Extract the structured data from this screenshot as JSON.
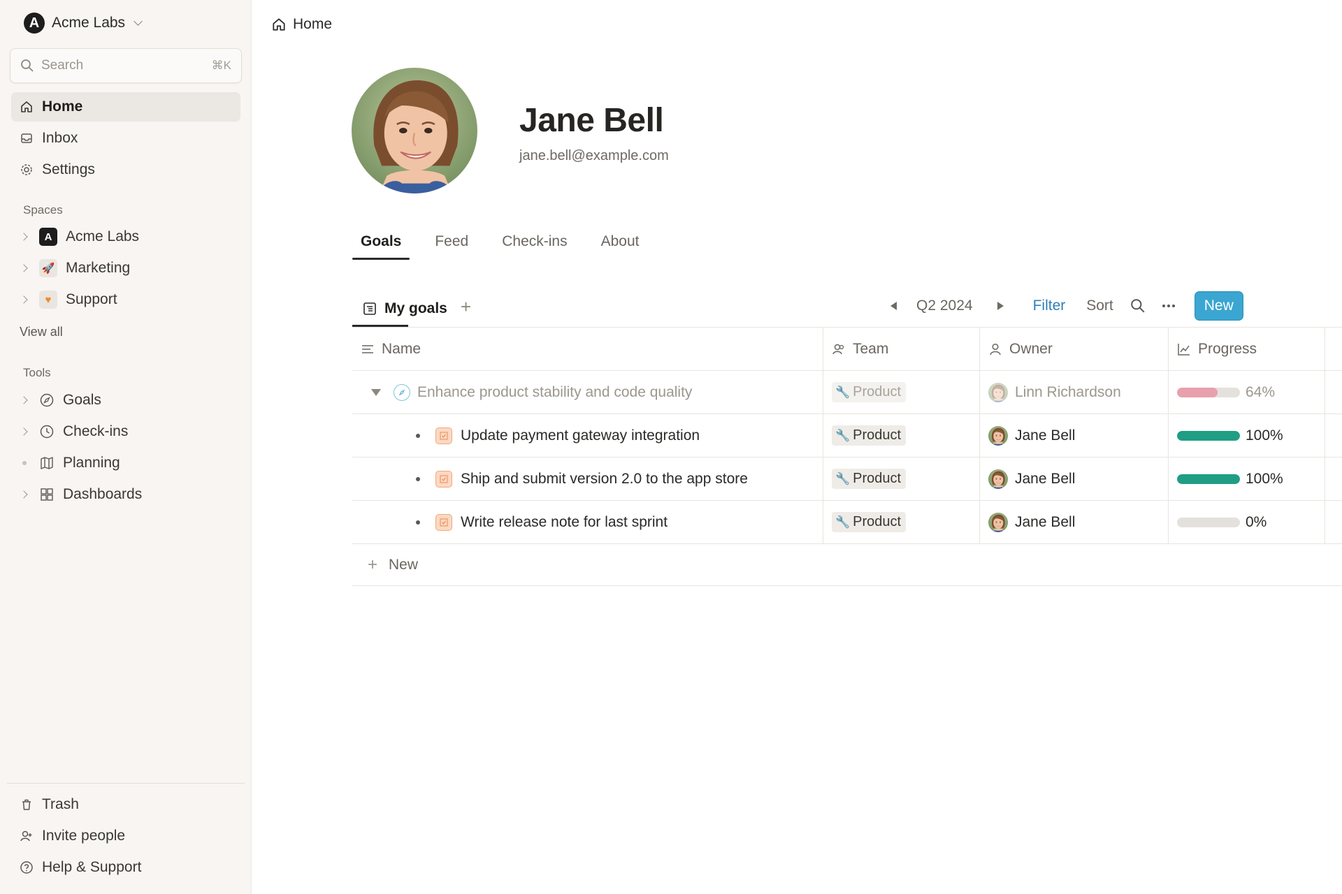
{
  "workspace": {
    "name": "Acme Labs"
  },
  "search": {
    "placeholder": "Search",
    "shortcut": "⌘K"
  },
  "nav": [
    {
      "label": "Home",
      "icon": "home-icon",
      "active": true
    },
    {
      "label": "Inbox",
      "icon": "inbox-icon"
    },
    {
      "label": "Settings",
      "icon": "gear-icon"
    }
  ],
  "spaces": {
    "label": "Spaces",
    "items": [
      {
        "label": "Acme Labs",
        "icon": "acme-logo-icon"
      },
      {
        "label": "Marketing",
        "icon": "rocket-icon"
      },
      {
        "label": "Support",
        "icon": "heart-icon"
      }
    ],
    "view_all": "View all"
  },
  "tools": {
    "label": "Tools",
    "items": [
      {
        "label": "Goals",
        "icon": "compass-icon"
      },
      {
        "label": "Check-ins",
        "icon": "clock-icon"
      },
      {
        "label": "Planning",
        "icon": "map-icon"
      },
      {
        "label": "Dashboards",
        "icon": "grid-icon"
      }
    ]
  },
  "footer": [
    {
      "label": "Trash",
      "icon": "trash-icon"
    },
    {
      "label": "Invite people",
      "icon": "invite-icon"
    },
    {
      "label": "Help & Support",
      "icon": "help-icon"
    }
  ],
  "breadcrumb": {
    "label": "Home"
  },
  "profile": {
    "name": "Jane Bell",
    "email": "jane.bell@example.com"
  },
  "tabs": [
    {
      "label": "Goals",
      "active": true
    },
    {
      "label": "Feed"
    },
    {
      "label": "Check-ins"
    },
    {
      "label": "About"
    }
  ],
  "view": {
    "name": "My goals",
    "period": "Q2 2024",
    "filter": "Filter",
    "sort": "Sort",
    "new": "New"
  },
  "columns": {
    "name": "Name",
    "team": "Team",
    "owner": "Owner",
    "progress": "Progress"
  },
  "rows": [
    {
      "name": "Enhance product stability and code quality",
      "team": "Product",
      "owner": "Linn Richardson",
      "progress": 64,
      "progress_label": "64%",
      "kind": "goal",
      "color": "#e8a0ac"
    },
    {
      "name": "Update payment gateway integration",
      "team": "Product",
      "owner": "Jane Bell",
      "progress": 100,
      "progress_label": "100%",
      "kind": "task",
      "color": "#1f9e84"
    },
    {
      "name": "Ship and submit version 2.0 to the app store",
      "team": "Product",
      "owner": "Jane Bell",
      "progress": 100,
      "progress_label": "100%",
      "kind": "task",
      "color": "#1f9e84"
    },
    {
      "name": "Write release note for last sprint",
      "team": "Product",
      "owner": "Jane Bell",
      "progress": 0,
      "progress_label": "0%",
      "kind": "task",
      "color": "#1f9e84"
    }
  ],
  "add_row": {
    "label": "New"
  },
  "colors": {
    "accent": "#3aa6d1",
    "link": "#2f7fb5",
    "complete": "#1f9e84",
    "at_risk": "#e8a0ac"
  }
}
